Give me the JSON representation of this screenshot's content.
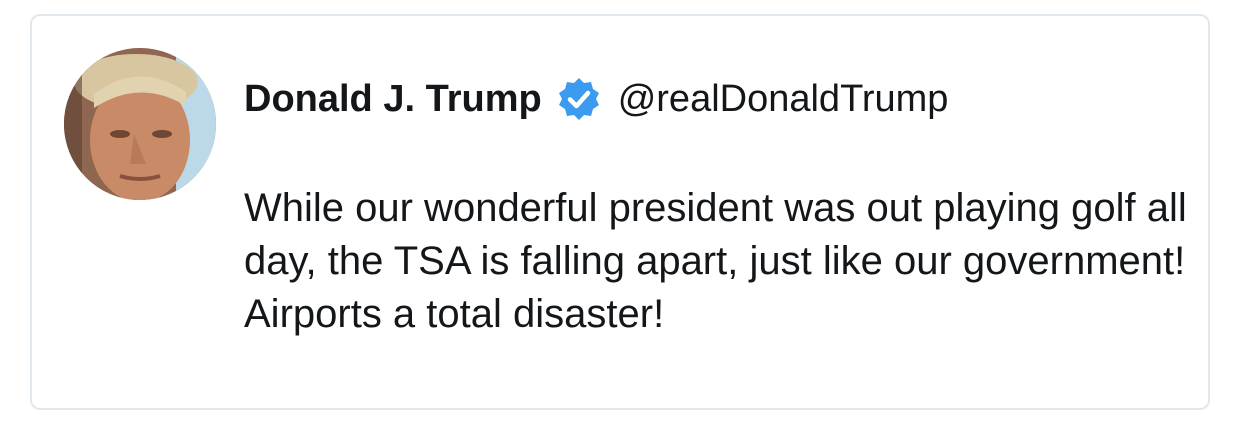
{
  "tweet": {
    "author": {
      "display_name": "Donald J. Trump",
      "handle": "@realDonaldTrump",
      "verified": true,
      "verified_icon": "verified-badge-icon",
      "avatar": "profile-photo"
    },
    "text": "While our wonderful president was out playing golf all day, the TSA is falling apart, just like our government! Airports a total disaster!"
  },
  "colors": {
    "text": "#14171a",
    "verified_badge": "#3a9bf0",
    "card_border": "#e1e8ed"
  }
}
